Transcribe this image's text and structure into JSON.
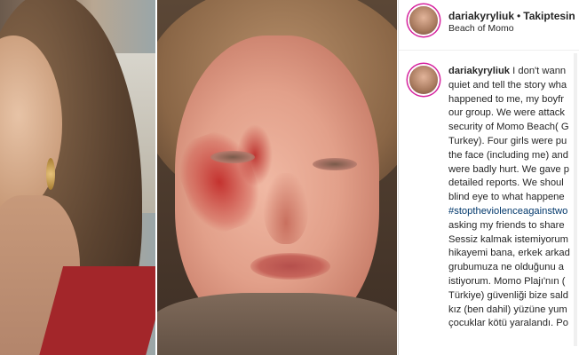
{
  "post": {
    "username": "dariakyryliuk",
    "follow_label": "Takiptesin",
    "separator": "•",
    "location": "Beach of Momo"
  },
  "caption": {
    "username": "dariakyryliuk",
    "text_part1": " I don't wann\nquiet and tell the story wha\nhappened to me, my boyfr\nour group. We were attack\nsecurity of Momo Beach( G\nTurkey). Four girls were pu\nthe face (including me) and\nwere badly hurt. We gave p\ndetailed reports. We shoul\nblind eye to what happene\n",
    "hashtag": "#stoptheviolenceagainstwo",
    "text_part2": "\nasking my friends to share\nSessiz kalmak istemiyorum\nhikayemi bana, erkek arkad\ngrubumuza ne olduğunu a\nistiyorum. Momo Plajı'nın (\nTürkiye) güvenliği bize sald\nkız (ben dahil) yüzüne yum\nçocuklar kötü yaralandı. Po"
  },
  "icons": [
    "avatar-icon"
  ],
  "colors": {
    "link": "#00376b",
    "text": "#262626",
    "story_ring": "#d6249f"
  }
}
